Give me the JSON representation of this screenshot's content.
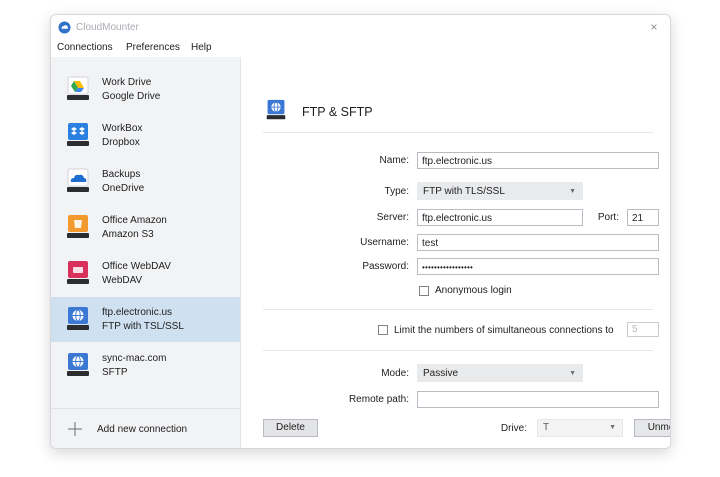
{
  "window": {
    "title": "CloudMounter",
    "close_glyph": "×"
  },
  "menu": {
    "items": [
      "Connections",
      "Preferences",
      "Help"
    ]
  },
  "sidebar": {
    "connections": [
      {
        "name": "Work Drive",
        "type": "Google Drive",
        "icon": "google-drive-icon",
        "color": "#34a853",
        "selected": false
      },
      {
        "name": "WorkBox",
        "type": "Dropbox",
        "icon": "dropbox-icon",
        "color": "#2a7fe0",
        "selected": false
      },
      {
        "name": "Backups",
        "type": "OneDrive",
        "icon": "onedrive-icon",
        "color": "#1f6fd1",
        "selected": false
      },
      {
        "name": "Office Amazon",
        "type": "Amazon S3",
        "icon": "amazon-s3-icon",
        "color": "#f29a2e",
        "selected": false
      },
      {
        "name": "Office WebDAV",
        "type": "WebDAV",
        "icon": "webdav-icon",
        "color": "#d8315b",
        "selected": false
      },
      {
        "name": "ftp.electronic.us",
        "type": "FTP with TSL/SSL",
        "icon": "ftp-globe-icon",
        "color": "#3a78d4",
        "selected": true
      },
      {
        "name": "sync-mac.com",
        "type": "SFTP",
        "icon": "sftp-globe-icon",
        "color": "#3a78d4",
        "selected": false
      }
    ],
    "add_label": "Add new connection"
  },
  "detail": {
    "title": "FTP & SFTP",
    "name_label": "Name:",
    "name_value": "ftp.electronic.us",
    "type_label": "Type:",
    "type_value": "FTP with TLS/SSL",
    "server_label": "Server:",
    "server_value": "ftp.electronic.us",
    "port_label": "Port:",
    "port_value": "21",
    "username_label": "Username:",
    "username_value": "test",
    "password_label": "Password:",
    "password_value": "•••••••••••••••••",
    "anonymous_label": "Anonymous login",
    "anonymous_checked": false,
    "limit_label": "Limit the numbers of simultaneous connections to",
    "limit_checked": false,
    "limit_value": "5",
    "mode_label": "Mode:",
    "mode_value": "Passive",
    "remote_label": "Remote path:",
    "remote_value": "",
    "delete_label": "Delete",
    "drive_label": "Drive:",
    "drive_value": "T",
    "unmount_label": "Unmount"
  },
  "colors": {
    "selection": "#cfe0f1",
    "sidebar_bg": "#f2f3f5",
    "accent": "#3a78d4"
  }
}
